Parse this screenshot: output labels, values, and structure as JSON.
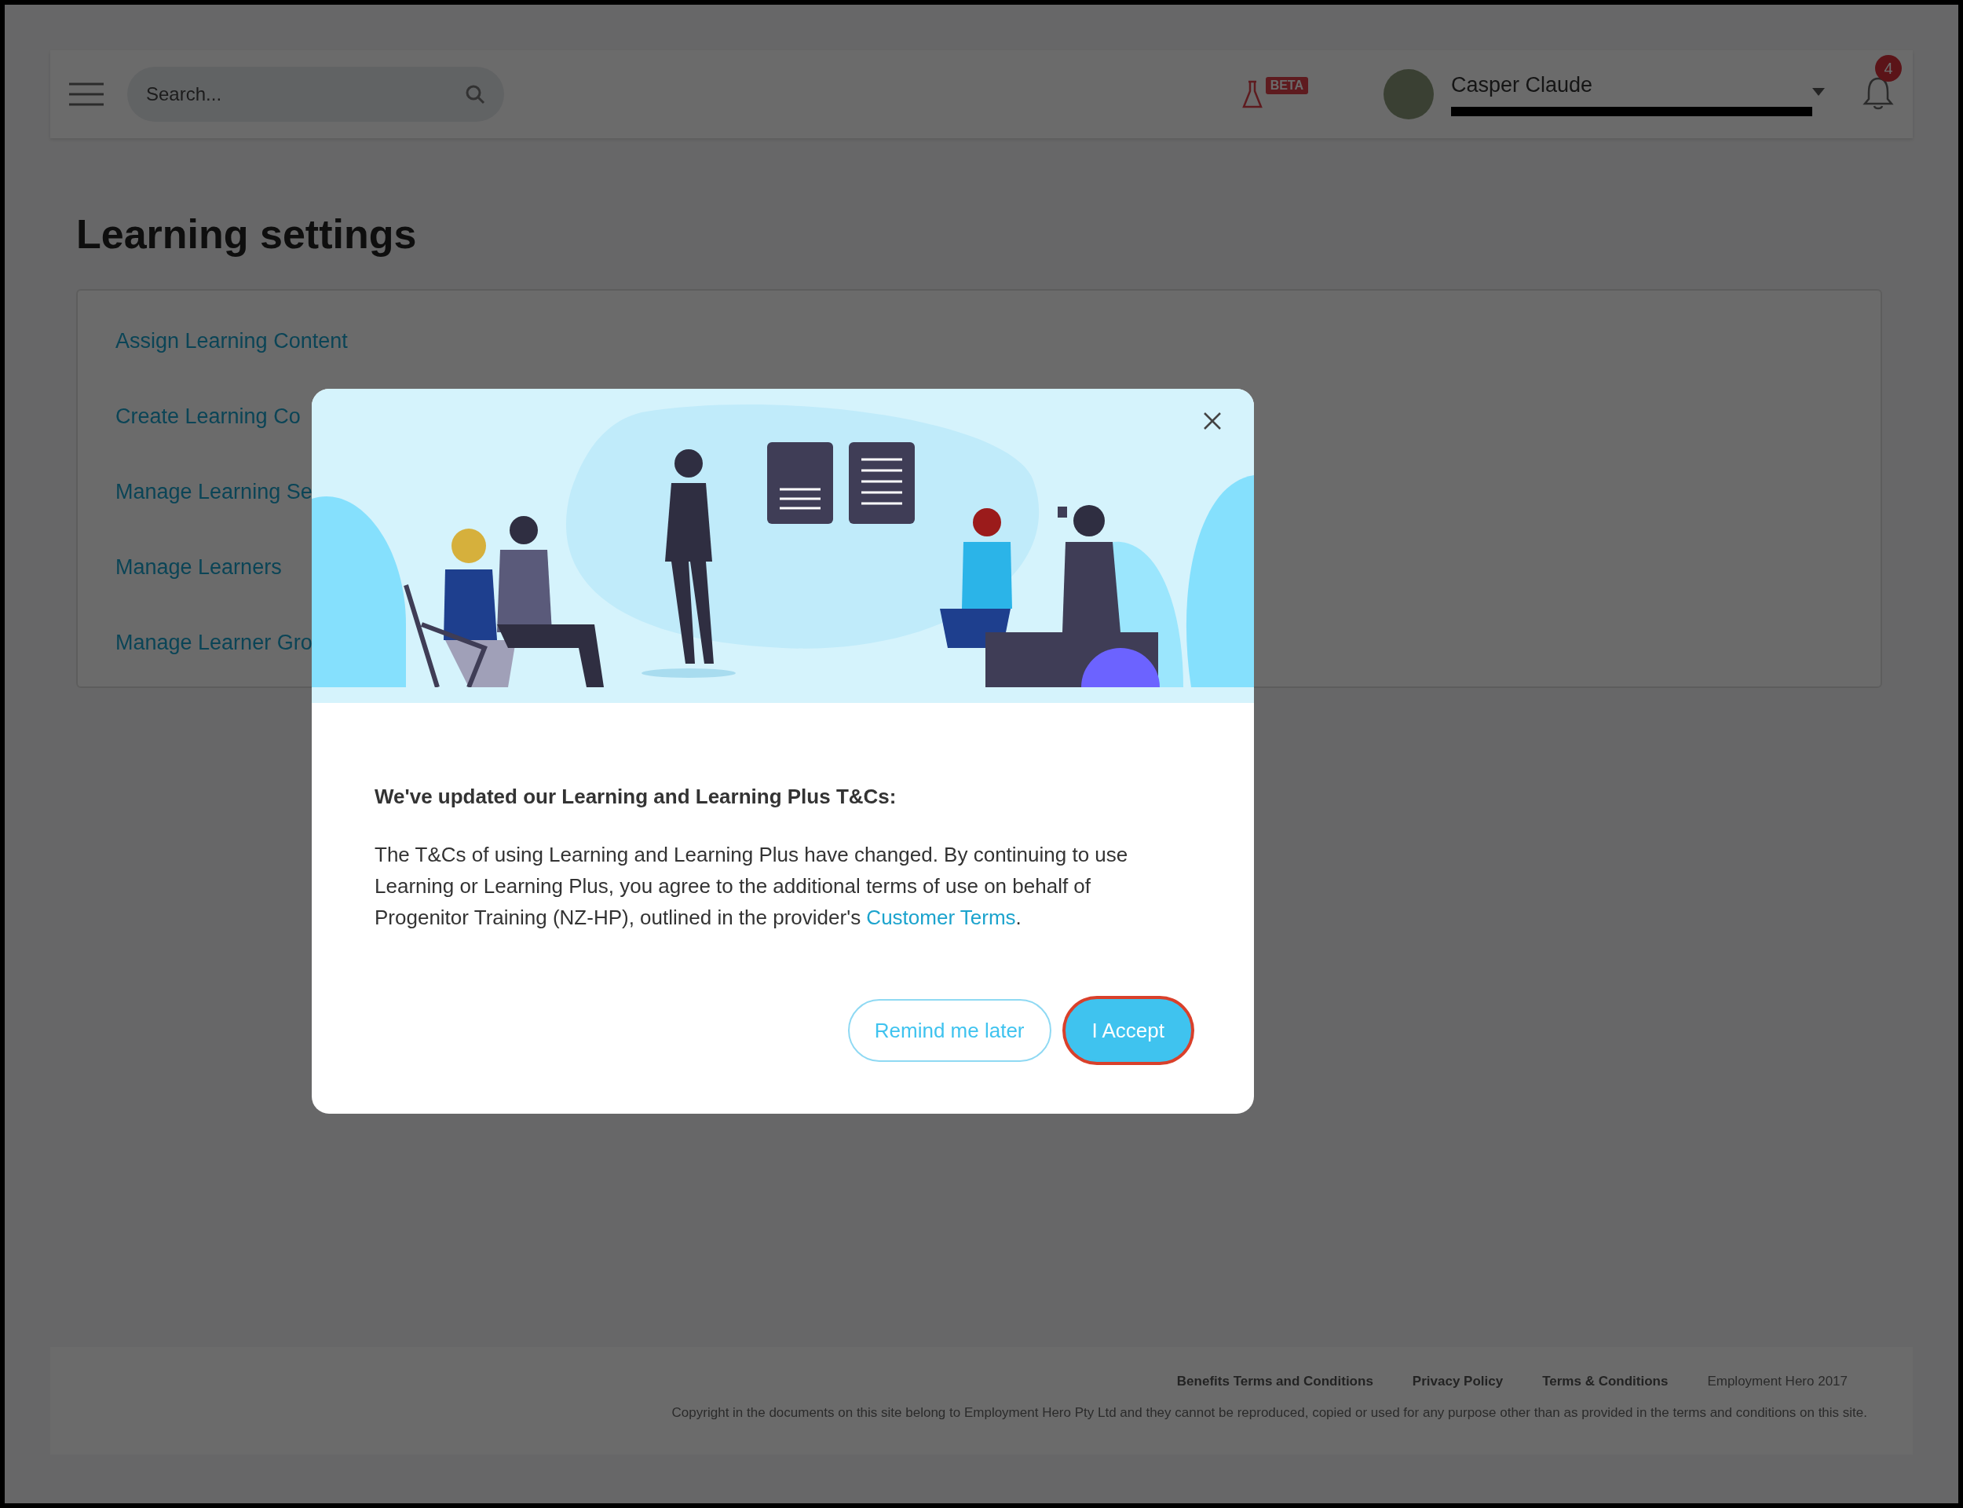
{
  "header": {
    "search": {
      "placeholder": "Search..."
    },
    "beta_badge": "BETA",
    "user": {
      "name": "Casper Claude"
    },
    "notifications": {
      "count": "4"
    }
  },
  "page": {
    "title": "Learning settings",
    "settings_links": [
      {
        "label": "Assign Learning Content"
      },
      {
        "label": "Create Learning Co"
      },
      {
        "label": "Manage Learning Se"
      },
      {
        "label": "Manage Learners"
      },
      {
        "label": "Manage Learner Gro"
      }
    ]
  },
  "modal": {
    "heading": "We've updated our Learning and Learning Plus T&Cs:",
    "body": "The T&Cs of using Learning and Learning Plus have changed. By continuing to use Learning or Learning Plus, you agree to the additional terms of use on behalf of Progenitor Training (NZ-HP), outlined in the provider's ",
    "link": "Customer Terms",
    "body_end": ".",
    "buttons": [
      {
        "label": "Remind me later",
        "kind": "outline",
        "focused": false
      },
      {
        "label": "I Accept",
        "kind": "primary",
        "focused": true
      }
    ]
  },
  "footer": {
    "links": [
      "Benefits Terms and Conditions",
      "Privacy Policy",
      "Terms & Conditions"
    ],
    "brand": "Employment Hero 2017",
    "copyright": "Copyright in the documents on this site belong to Employment Hero Pty Ltd and they cannot be reproduced, copied or used for any purpose other than as provided in the terms and conditions on this site."
  }
}
